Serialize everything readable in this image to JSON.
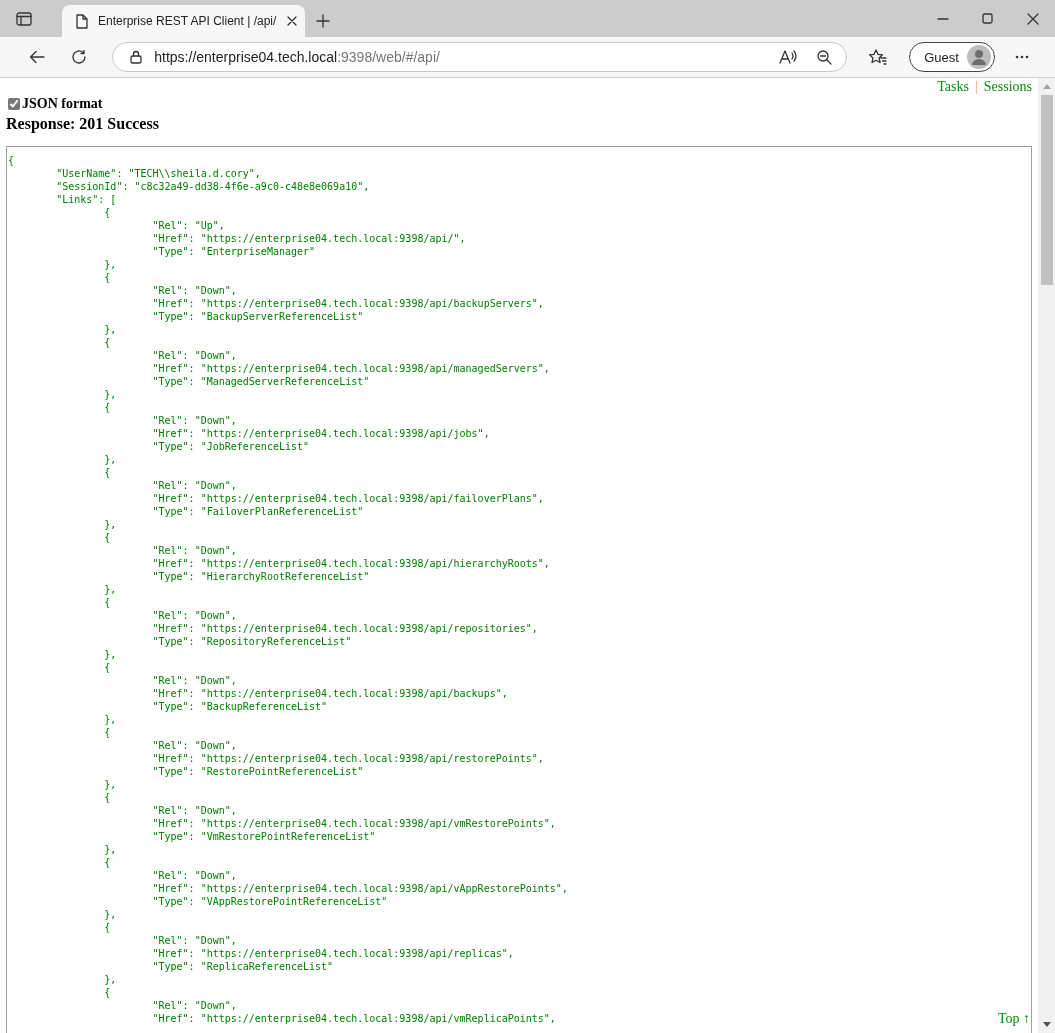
{
  "browser": {
    "tab_title": "Enterprise REST API Client | /api/",
    "url_host": "https://enterprise04.tech.local",
    "url_rest": ":9398/web/#/api/",
    "profile": "Guest"
  },
  "page": {
    "nav_links": [
      "Tasks",
      "Sessions"
    ],
    "nav_separator": "|",
    "json_format": {
      "label": "JSON format",
      "checked": true
    },
    "response_status": "Response: 201 Success",
    "response_body": [
      "{",
      "\t\"UserName\": \"TECH\\\\sheila.d.cory\",",
      "\t\"SessionId\": \"c8c32a49-dd38-4f6e-a9c0-c48e8e069a10\",",
      "\t\"Links\": [",
      "\t\t{",
      "\t\t\t\"Rel\": \"Up\",",
      "\t\t\t\"Href\": \"https://enterprise04.tech.local:9398/api/\",",
      "\t\t\t\"Type\": \"EnterpriseManager\"",
      "\t\t},",
      "\t\t{",
      "\t\t\t\"Rel\": \"Down\",",
      "\t\t\t\"Href\": \"https://enterprise04.tech.local:9398/api/backupServers\",",
      "\t\t\t\"Type\": \"BackupServerReferenceList\"",
      "\t\t},",
      "\t\t{",
      "\t\t\t\"Rel\": \"Down\",",
      "\t\t\t\"Href\": \"https://enterprise04.tech.local:9398/api/managedServers\",",
      "\t\t\t\"Type\": \"ManagedServerReferenceList\"",
      "\t\t},",
      "\t\t{",
      "\t\t\t\"Rel\": \"Down\",",
      "\t\t\t\"Href\": \"https://enterprise04.tech.local:9398/api/jobs\",",
      "\t\t\t\"Type\": \"JobReferenceList\"",
      "\t\t},",
      "\t\t{",
      "\t\t\t\"Rel\": \"Down\",",
      "\t\t\t\"Href\": \"https://enterprise04.tech.local:9398/api/failoverPlans\",",
      "\t\t\t\"Type\": \"FailoverPlanReferenceList\"",
      "\t\t},",
      "\t\t{",
      "\t\t\t\"Rel\": \"Down\",",
      "\t\t\t\"Href\": \"https://enterprise04.tech.local:9398/api/hierarchyRoots\",",
      "\t\t\t\"Type\": \"HierarchyRootReferenceList\"",
      "\t\t},",
      "\t\t{",
      "\t\t\t\"Rel\": \"Down\",",
      "\t\t\t\"Href\": \"https://enterprise04.tech.local:9398/api/repositories\",",
      "\t\t\t\"Type\": \"RepositoryReferenceList\"",
      "\t\t},",
      "\t\t{",
      "\t\t\t\"Rel\": \"Down\",",
      "\t\t\t\"Href\": \"https://enterprise04.tech.local:9398/api/backups\",",
      "\t\t\t\"Type\": \"BackupReferenceList\"",
      "\t\t},",
      "\t\t{",
      "\t\t\t\"Rel\": \"Down\",",
      "\t\t\t\"Href\": \"https://enterprise04.tech.local:9398/api/restorePoints\",",
      "\t\t\t\"Type\": \"RestorePointReferenceList\"",
      "\t\t},",
      "\t\t{",
      "\t\t\t\"Rel\": \"Down\",",
      "\t\t\t\"Href\": \"https://enterprise04.tech.local:9398/api/vmRestorePoints\",",
      "\t\t\t\"Type\": \"VmRestorePointReferenceList\"",
      "\t\t},",
      "\t\t{",
      "\t\t\t\"Rel\": \"Down\",",
      "\t\t\t\"Href\": \"https://enterprise04.tech.local:9398/api/vAppRestorePoints\",",
      "\t\t\t\"Type\": \"VAppRestorePointReferenceList\"",
      "\t\t},",
      "\t\t{",
      "\t\t\t\"Rel\": \"Down\",",
      "\t\t\t\"Href\": \"https://enterprise04.tech.local:9398/api/replicas\",",
      "\t\t\t\"Type\": \"ReplicaReferenceList\"",
      "\t\t},",
      "\t\t{",
      "\t\t\t\"Rel\": \"Down\",",
      "\t\t\t\"Href\": \"https://enterprise04.tech.local:9398/api/vmReplicaPoints\","
    ],
    "top_link": "Top ↑"
  }
}
